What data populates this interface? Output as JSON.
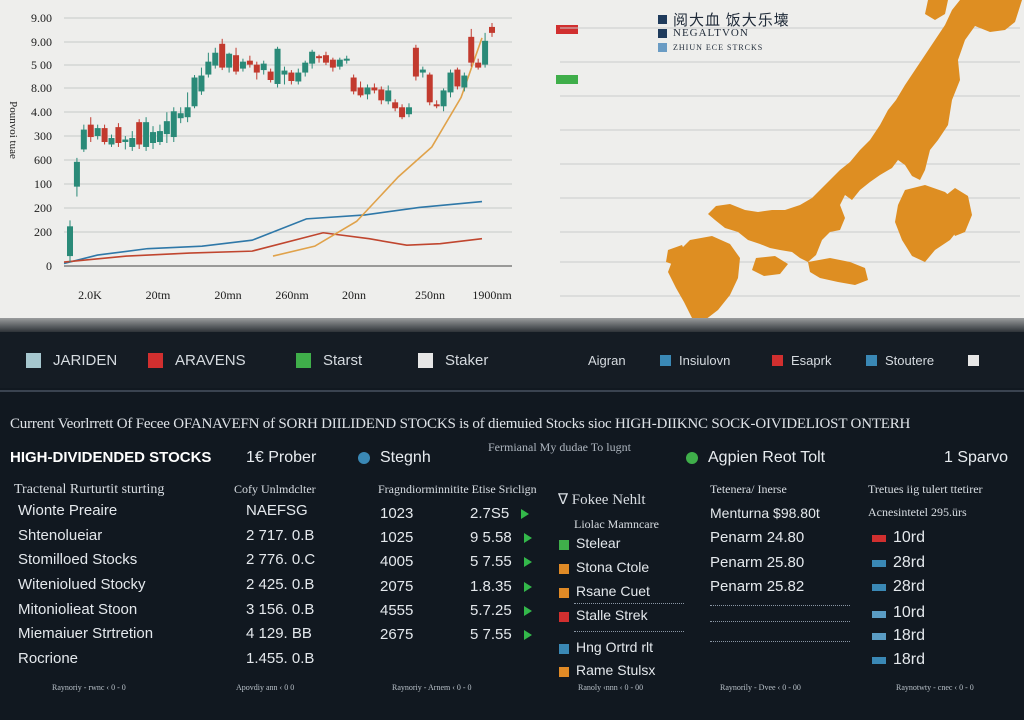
{
  "chart_data": {
    "type": "candlestick",
    "yticks": [
      "9.00",
      "9.00",
      "5 00",
      "8.00",
      "4.00",
      "300",
      "600",
      "100",
      "200",
      "200",
      "0"
    ],
    "xticks": [
      "2.0K",
      "20tm",
      "20mn",
      "260nm",
      "20nn",
      "250nn",
      "1900nm"
    ],
    "ylabel": "Pounvoi tuae",
    "candles": [
      {
        "o": 20,
        "c": 80,
        "h": 92,
        "l": 8
      },
      {
        "o": 160,
        "c": 210,
        "h": 218,
        "l": 140
      },
      {
        "o": 235,
        "c": 275,
        "h": 285,
        "l": 230
      },
      {
        "o": 285,
        "c": 260,
        "h": 300,
        "l": 250
      },
      {
        "o": 262,
        "c": 278,
        "h": 285,
        "l": 255
      },
      {
        "o": 278,
        "c": 250,
        "h": 285,
        "l": 245
      },
      {
        "o": 245,
        "c": 258,
        "h": 265,
        "l": 240
      },
      {
        "o": 280,
        "c": 248,
        "h": 288,
        "l": 240
      },
      {
        "o": 250,
        "c": 255,
        "h": 262,
        "l": 235
      },
      {
        "o": 240,
        "c": 258,
        "h": 272,
        "l": 232
      },
      {
        "o": 290,
        "c": 245,
        "h": 296,
        "l": 236
      },
      {
        "o": 240,
        "c": 290,
        "h": 300,
        "l": 232
      },
      {
        "o": 248,
        "c": 270,
        "h": 282,
        "l": 236
      },
      {
        "o": 250,
        "c": 272,
        "h": 285,
        "l": 244
      },
      {
        "o": 266,
        "c": 292,
        "h": 310,
        "l": 248
      },
      {
        "o": 260,
        "c": 312,
        "h": 320,
        "l": 250
      },
      {
        "o": 298,
        "c": 308,
        "h": 320,
        "l": 288
      },
      {
        "o": 300,
        "c": 320,
        "h": 350,
        "l": 290
      },
      {
        "o": 322,
        "c": 380,
        "h": 385,
        "l": 318
      },
      {
        "o": 352,
        "c": 384,
        "h": 400,
        "l": 345
      },
      {
        "o": 386,
        "c": 412,
        "h": 430,
        "l": 380
      },
      {
        "o": 404,
        "c": 430,
        "h": 440,
        "l": 398
      },
      {
        "o": 448,
        "c": 400,
        "h": 458,
        "l": 395
      },
      {
        "o": 400,
        "c": 428,
        "h": 430,
        "l": 390
      },
      {
        "o": 425,
        "c": 392,
        "h": 440,
        "l": 386
      },
      {
        "o": 398,
        "c": 412,
        "h": 418,
        "l": 392
      },
      {
        "o": 414,
        "c": 406,
        "h": 424,
        "l": 400
      },
      {
        "o": 406,
        "c": 390,
        "h": 412,
        "l": 376
      },
      {
        "o": 395,
        "c": 408,
        "h": 414,
        "l": 386
      },
      {
        "o": 392,
        "c": 375,
        "h": 398,
        "l": 370
      },
      {
        "o": 367,
        "c": 438,
        "h": 442,
        "l": 360
      },
      {
        "o": 386,
        "c": 394,
        "h": 402,
        "l": 366
      },
      {
        "o": 390,
        "c": 373,
        "h": 395,
        "l": 366
      },
      {
        "o": 372,
        "c": 390,
        "h": 398,
        "l": 366
      },
      {
        "o": 390,
        "c": 410,
        "h": 414,
        "l": 382
      },
      {
        "o": 408,
        "c": 432,
        "h": 436,
        "l": 398
      },
      {
        "o": 423,
        "c": 420,
        "h": 426,
        "l": 410
      },
      {
        "o": 425,
        "c": 410,
        "h": 432,
        "l": 405
      },
      {
        "o": 416,
        "c": 400,
        "h": 420,
        "l": 392
      },
      {
        "o": 402,
        "c": 416,
        "h": 420,
        "l": 396
      },
      {
        "o": 416,
        "c": 418,
        "h": 424,
        "l": 408
      },
      {
        "o": 380,
        "c": 352,
        "h": 386,
        "l": 346
      },
      {
        "o": 360,
        "c": 344,
        "h": 372,
        "l": 340
      },
      {
        "o": 346,
        "c": 360,
        "h": 366,
        "l": 336
      },
      {
        "o": 360,
        "c": 354,
        "h": 368,
        "l": 348
      },
      {
        "o": 356,
        "c": 334,
        "h": 362,
        "l": 326
      },
      {
        "o": 332,
        "c": 354,
        "h": 364,
        "l": 326
      },
      {
        "o": 330,
        "c": 318,
        "h": 336,
        "l": 312
      },
      {
        "o": 320,
        "c": 300,
        "h": 326,
        "l": 296
      },
      {
        "o": 306,
        "c": 320,
        "h": 328,
        "l": 300
      },
      {
        "o": 440,
        "c": 382,
        "h": 446,
        "l": 374
      },
      {
        "o": 390,
        "c": 396,
        "h": 402,
        "l": 380
      },
      {
        "o": 386,
        "c": 330,
        "h": 390,
        "l": 324
      },
      {
        "o": 326,
        "c": 322,
        "h": 334,
        "l": 318
      },
      {
        "o": 322,
        "c": 354,
        "h": 358,
        "l": 312
      },
      {
        "o": 350,
        "c": 390,
        "h": 396,
        "l": 340
      },
      {
        "o": 396,
        "c": 362,
        "h": 400,
        "l": 356
      },
      {
        "o": 360,
        "c": 384,
        "h": 390,
        "l": 352
      },
      {
        "o": 462,
        "c": 410,
        "h": 478,
        "l": 402
      },
      {
        "o": 410,
        "c": 400,
        "h": 418,
        "l": 396
      },
      {
        "o": 406,
        "c": 454,
        "h": 470,
        "l": 400
      },
      {
        "o": 482,
        "c": 470,
        "h": 490,
        "l": 462
      }
    ],
    "lines": [
      {
        "color": "#2f78a8",
        "points": [
          [
            0.0,
            5
          ],
          [
            0.08,
            22
          ],
          [
            0.2,
            35
          ],
          [
            0.33,
            40
          ],
          [
            0.45,
            52
          ],
          [
            0.58,
            95
          ],
          [
            0.72,
            103
          ],
          [
            0.85,
            118
          ],
          [
            1.0,
            130
          ]
        ]
      },
      {
        "color": "#c0462f",
        "points": [
          [
            0.0,
            8
          ],
          [
            0.15,
            20
          ],
          [
            0.3,
            26
          ],
          [
            0.45,
            30
          ],
          [
            0.62,
            67
          ],
          [
            0.73,
            55
          ],
          [
            0.82,
            42
          ],
          [
            0.9,
            45
          ],
          [
            1.0,
            55
          ]
        ]
      },
      {
        "color": "#e0a24a",
        "points": [
          [
            0.5,
            20
          ],
          [
            0.6,
            40
          ],
          [
            0.7,
            90
          ],
          [
            0.8,
            180
          ],
          [
            0.88,
            240
          ],
          [
            0.95,
            340
          ],
          [
            1.0,
            460
          ]
        ]
      }
    ],
    "grid": true
  },
  "side_swatches": [
    "#d12f2f",
    "#3fae4a"
  ],
  "map_legend": [
    {
      "color": "#1f3b5c",
      "text": "阅大血 饭大乐壊"
    },
    {
      "color": "#1f3b5c",
      "text": "NEGALTVON"
    },
    {
      "color": "#6a9cc4",
      "text": "ZHIUN ECE STRCKS"
    }
  ],
  "legend_bar": [
    {
      "color": "#a6c7cf",
      "label": "JARIDEN"
    },
    {
      "color": "#d12f2f",
      "label": "ARAVENS"
    },
    {
      "color": "#3fae4a",
      "label": "Starst"
    },
    {
      "color": "#e6e6e6",
      "label": "Staker"
    },
    {
      "color": "",
      "label": "Aigran"
    },
    {
      "color": "#3a88b5",
      "label": "Insiulovn"
    },
    {
      "color": "#d12f2f",
      "label": "Esaprk"
    },
    {
      "color": "#3a88b5",
      "label": "Stoutere"
    },
    {
      "color": "#e6e6e6",
      "label": ""
    }
  ],
  "headline": "Current Veorlrrett Of Fecee OFANAVEFN of SORH DIILIDEND STOCKS is of diemuied Stocks sioc HIGH-DIIKNC SOCK-OIVIDELIOST ONTERH",
  "subheadline": "Fermianal My dudae To lugnt",
  "table_title": "HIGH-DIVIDENDED STOCKS",
  "headers": [
    {
      "icon": "",
      "color": "",
      "label": "1€ Prober"
    },
    {
      "icon": "dot",
      "color": "#3a88b5",
      "label": "Stegnh"
    },
    {
      "icon": "dot",
      "color": "#3fae4a",
      "label": "Agpien Reot Tolt"
    },
    {
      "icon": "",
      "color": "",
      "label": "1 Sparvo"
    }
  ],
  "col_heads": [
    "Tractenal Rurturtit sturting",
    "Cofy Unlmdclter",
    "Fragndiorminnitite Etise Sriclign",
    "∇ Fokee Nehlt",
    "Tetenera/ Inerse",
    "Tretues iig tulert ttetirer"
  ],
  "col_subheads": [
    "Liolac Mamncare",
    "Acnesintetel 295.ürs"
  ],
  "names": [
    "Wionte Preaire",
    "Shtenolueiar",
    "Stomilloed Stocks",
    "Witeniolued Stocky",
    "Mitoniolieat Stoon",
    "Miemaiuer Strtretion",
    "Rocrione"
  ],
  "codes": [
    "NAEFSG",
    "2 717. 0.B",
    "2 776. 0.C",
    "2 425. 0.B",
    "3 156. 0.B",
    "4 129. BB",
    "1.455. 0.B"
  ],
  "volumes": [
    "1023",
    "1025",
    "4005",
    "2075",
    "4555",
    "2675"
  ],
  "prices": [
    "2.7S5",
    "9 5.58",
    "5 7.55",
    "1.8.35",
    "5.7.25",
    "5 7.55"
  ],
  "categories": [
    {
      "color": "#3fae4a",
      "label": "Stelear"
    },
    {
      "color": "#e08a26",
      "label": "Stona Ctole"
    },
    {
      "color": "#e08a26",
      "label": "Rsane Cuet"
    },
    {
      "color": "#d12f2f",
      "label": "Stalle Strek"
    },
    {
      "color": "#3a88b5",
      "label": "Hng Ortrd rlt"
    },
    {
      "color": "#e08a26",
      "label": "Rame Stulsx"
    }
  ],
  "momentum": [
    "Menturna $98.80t",
    "Penarm 24.80",
    "Penarm 25.80",
    "Penarm 25.82"
  ],
  "ranks": [
    {
      "color": "#d12f2f",
      "label": "10rd"
    },
    {
      "color": "#3a88b5",
      "label": "28rd"
    },
    {
      "color": "#3a88b5",
      "label": "28rd"
    },
    {
      "color": "#5a9cc4",
      "label": "10rd"
    },
    {
      "color": "#5a9cc4",
      "label": "18rd"
    },
    {
      "color": "#3a88b5",
      "label": "18rd"
    }
  ],
  "footers": [
    "Raynoriy - rwnc   ‹   0 - 0",
    "Apovdiy  ann   ‹   0 0",
    "Raynoriy - Arnem   ‹   0 - 0",
    "Ranoly   ‹nnn   ‹   0 - 00",
    "Raynorily - Dvee   ‹   0 - 00",
    "Raynotwty - cnec   ‹   0 - 0"
  ]
}
